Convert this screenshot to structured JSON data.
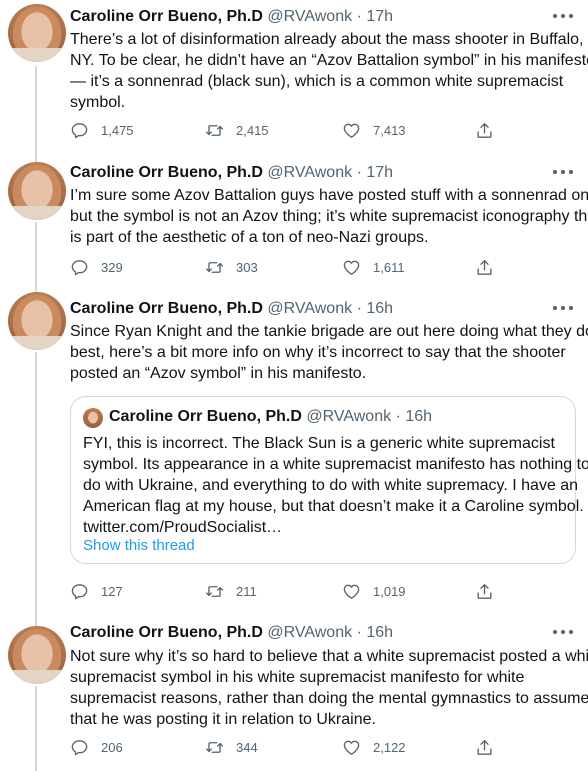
{
  "author": {
    "name": "Caroline Orr Bueno, Ph.D",
    "handle": "@RVAwonk",
    "separator": "·"
  },
  "tweets": [
    {
      "time": "17h",
      "lines": [
        "There’s a lot of disinformation already about the mass shooter in Buffalo,",
        "NY. To be clear, he didn’t have an “Azov Battalion symbol” in his manifesto",
        "— it’s a sonnenrad (black sun), which is a common white supremacist",
        "symbol."
      ],
      "replies": "1,475",
      "retweets": "2,415",
      "likes": "7,413"
    },
    {
      "time": "17h",
      "lines": [
        "I’m sure some Azov Battalion guys have posted stuff with a sonnenrad on it,",
        "but the symbol is not an Azov thing; it’s white supremacist iconography that",
        "is part of the aesthetic of a ton of neo-Nazi groups."
      ],
      "replies": "329",
      "retweets": "303",
      "likes": "1,611"
    },
    {
      "time": "16h",
      "lines": [
        "Since Ryan Knight and the tankie brigade are out here doing what they do",
        "best, here’s a bit more info on why it’s incorrect to say that the shooter",
        "posted an “Azov symbol” in his manifesto."
      ],
      "quote": {
        "time": "16h",
        "lines": [
          "FYI, this is incorrect. The Black Sun is a generic white supremacist",
          "symbol. Its appearance in a white supremacist manifesto has nothing to",
          "do with Ukraine, and everything to do with white supremacy. I have an",
          "American flag at my house, but that doesn’t make it a Caroline symbol.",
          "twitter.com/ProudSocialist…"
        ],
        "show_thread": "Show this thread"
      },
      "replies": "127",
      "retweets": "211",
      "likes": "1,019"
    },
    {
      "time": "16h",
      "lines": [
        "Not sure why it’s so hard to believe that a white supremacist posted a white",
        "supremacist symbol in his white supremacist manifesto for white",
        "supremacist reasons, rather than doing the mental gymnastics to assume",
        "that he was posting it in relation to Ukraine."
      ],
      "replies": "206",
      "retweets": "344",
      "likes": "2,122"
    }
  ]
}
